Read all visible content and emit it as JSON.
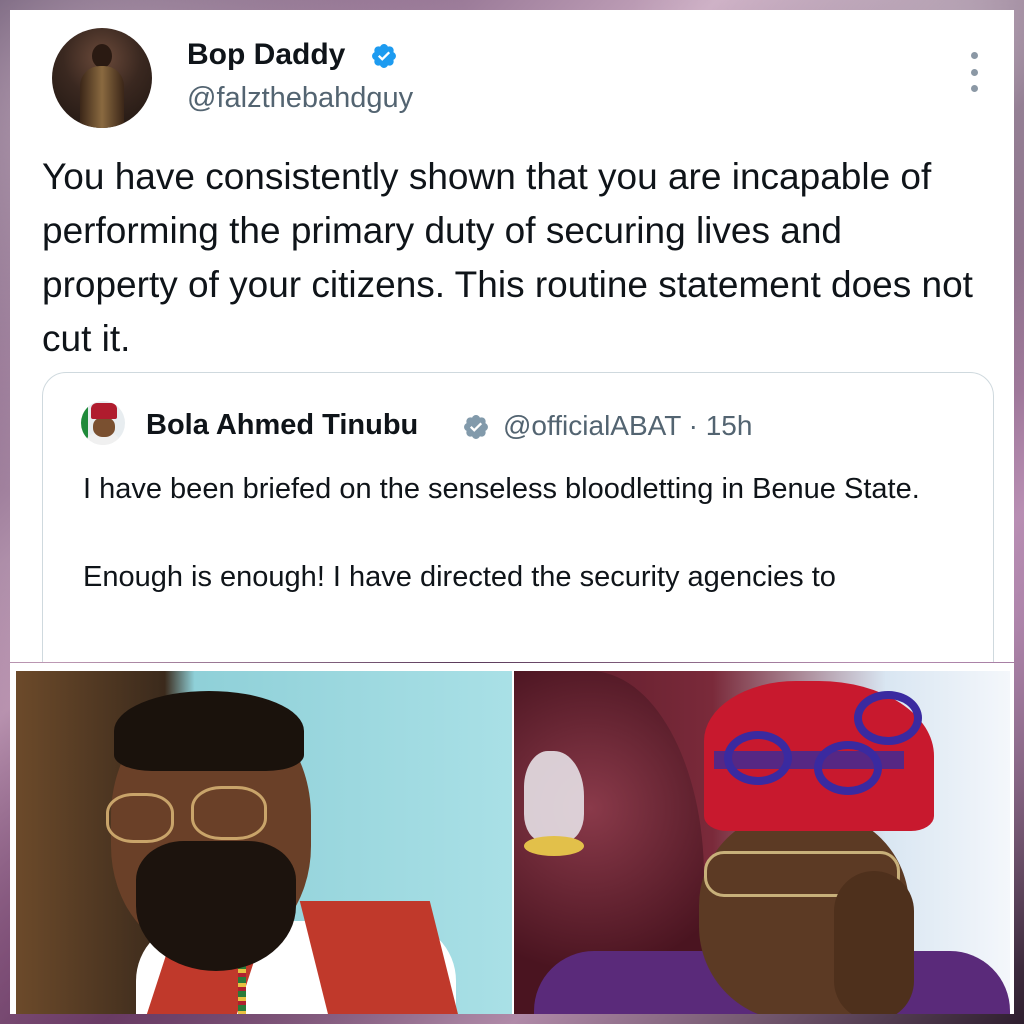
{
  "tweet": {
    "author_name": "Bop Daddy",
    "author_handle": "@falzthebahdguy",
    "verified_icon": "verified-badge-icon",
    "more_icon": "more-options-icon",
    "text": "You have consistently shown that you are incapable of performing the primary duty of securing lives and property of your citizens. This routine statement does not cut it."
  },
  "quoted_tweet": {
    "author_name": "Bola Ahmed Tinubu",
    "author_handle": "@officialABAT · 15h",
    "verified_icon": "verified-badge-gray-icon",
    "paragraph_1": "I have been briefed on the senseless bloodletting in Benue State.",
    "paragraph_2": "Enough is enough! I have directed the security agencies to"
  },
  "colors": {
    "text_primary": "#0f1419",
    "text_secondary": "#536471",
    "verified_blue": "#1d9bf0",
    "verified_gray": "#829aab",
    "border": "#cfd9de"
  }
}
